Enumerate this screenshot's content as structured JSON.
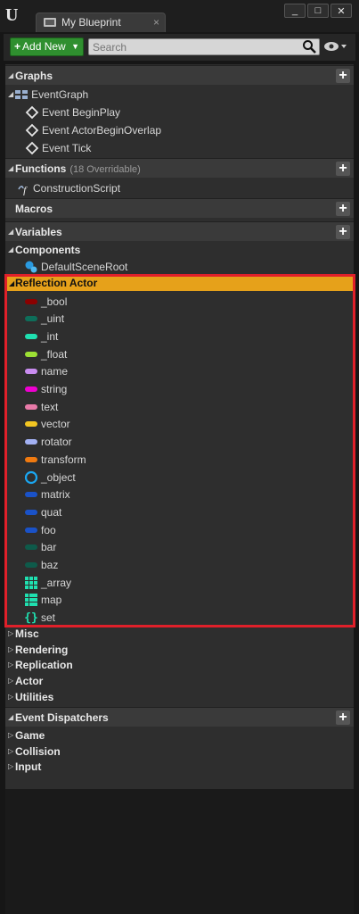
{
  "window": {
    "tab_label": "My Blueprint",
    "tab_close": "×",
    "logo": "U",
    "win_buttons": [
      "_",
      "□",
      "✕"
    ]
  },
  "toolbar": {
    "add_new_label": "Add New",
    "search_placeholder": "Search"
  },
  "graphs": {
    "header": "Graphs",
    "items": [
      {
        "label": "EventGraph",
        "icon": "graph-icon"
      },
      {
        "label": "Event BeginPlay",
        "icon": "event-icon"
      },
      {
        "label": "Event ActorBeginOverlap",
        "icon": "event-icon"
      },
      {
        "label": "Event Tick",
        "icon": "event-icon"
      }
    ]
  },
  "functions": {
    "header": "Functions",
    "overridable": "(18 Overridable)",
    "items": [
      {
        "label": "ConstructionScript",
        "icon": "function-icon"
      }
    ]
  },
  "macros": {
    "header": "Macros"
  },
  "variables": {
    "header": "Variables",
    "components_header": "Components",
    "components": [
      {
        "label": "DefaultSceneRoot",
        "icon": "scene-root-icon"
      }
    ],
    "reflection_header": "Reflection Actor",
    "reflection_items": [
      {
        "label": "_bool",
        "color": "#8c0000",
        "kind": "pill"
      },
      {
        "label": "_uint",
        "color": "#0e6e5a",
        "kind": "pill"
      },
      {
        "label": "_int",
        "color": "#1fe0b0",
        "kind": "pill"
      },
      {
        "label": "_float",
        "color": "#9ce034",
        "kind": "pill"
      },
      {
        "label": "name",
        "color": "#c98cf0",
        "kind": "pill"
      },
      {
        "label": "string",
        "color": "#ee00d0",
        "kind": "pill"
      },
      {
        "label": "text",
        "color": "#e87aa8",
        "kind": "pill"
      },
      {
        "label": "vector",
        "color": "#f2c622",
        "kind": "pill"
      },
      {
        "label": "rotator",
        "color": "#a2b0f2",
        "kind": "pill"
      },
      {
        "label": "transform",
        "color": "#f07a10",
        "kind": "pill"
      },
      {
        "label": "_object",
        "color": "#1aa6f0",
        "kind": "ring"
      },
      {
        "label": "matrix",
        "color": "#1a52c8",
        "kind": "pill"
      },
      {
        "label": "quat",
        "color": "#1a52c8",
        "kind": "pill"
      },
      {
        "label": "foo",
        "color": "#1a52c8",
        "kind": "pill"
      },
      {
        "label": "bar",
        "color": "#0e5a4a",
        "kind": "pill"
      },
      {
        "label": "baz",
        "color": "#0e5a4a",
        "kind": "pill"
      },
      {
        "label": "_array",
        "color": "#1fe0b0",
        "kind": "grid"
      },
      {
        "label": "map",
        "color": "#1fe0b0",
        "kind": "map"
      },
      {
        "label": "set",
        "color": "#1fe0b0",
        "kind": "braces"
      }
    ],
    "collapsed_categories": [
      "Misc",
      "Rendering",
      "Replication",
      "Actor",
      "Utilities"
    ]
  },
  "event_dispatchers": {
    "header": "Event Dispatchers",
    "categories": [
      "Game",
      "Collision",
      "Input"
    ]
  },
  "colors": {
    "highlight": "#e6a11a",
    "selection_outline": "#e0202a",
    "add_new": "#2f8f2f"
  }
}
